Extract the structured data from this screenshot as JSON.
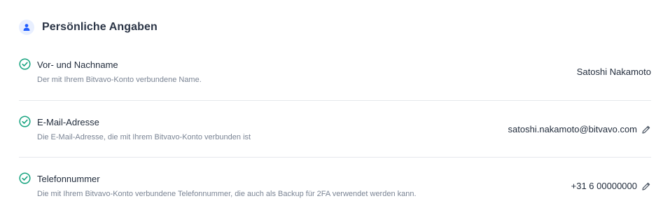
{
  "section": {
    "title": "Persönliche Angaben",
    "icon": "user-icon",
    "accent_color": "#1f5cff",
    "check_color": "#16a37f"
  },
  "fields": [
    {
      "label": "Vor- und Nachname",
      "description": "Der mit Ihrem Bitvavo-Konto verbundene Name.",
      "value": "Satoshi Nakamoto",
      "editable": false,
      "status_icon": "check-circle-icon"
    },
    {
      "label": "E-Mail-Adresse",
      "description": "Die E-Mail-Adresse, die mit Ihrem Bitvavo-Konto verbunden ist",
      "value": "satoshi.nakamoto@bitvavo.com",
      "editable": true,
      "status_icon": "check-circle-icon",
      "action_icon": "pencil-icon"
    },
    {
      "label": "Telefonnummer",
      "description": "Die mit Ihrem Bitvavo-Konto verbundene Telefonnummer, die auch als Backup für 2FA verwendet werden kann.",
      "value": "+31 6 00000000",
      "editable": true,
      "status_icon": "check-circle-icon",
      "action_icon": "pencil-icon"
    }
  ]
}
